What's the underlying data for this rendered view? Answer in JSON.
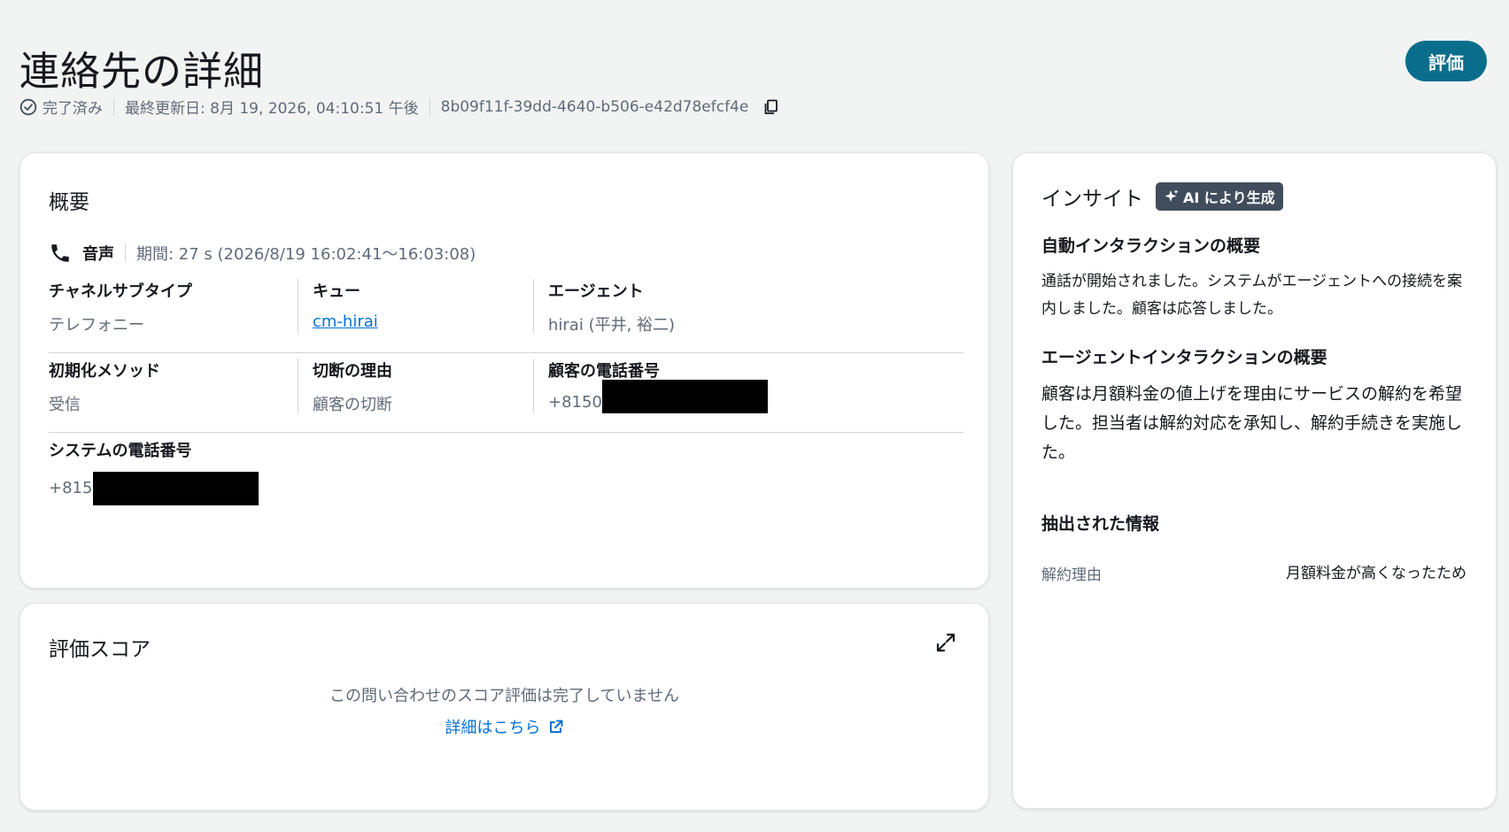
{
  "header": {
    "title": "連絡先の詳細",
    "status": "完了済み",
    "last_updated": "最終更新日: 8月 19, 2026, 04:10:51 午後",
    "contact_id": "8b09f11f-39dd-4640-b506-e42d78efcf4e",
    "evaluate_button": "評価",
    "accent_color": "#0a6d8c"
  },
  "overview": {
    "title": "概要",
    "channel_type": "音声",
    "duration": "期間: 27 s (2026/8/19 16:02:41〜16:03:08)",
    "fields": {
      "channel_subtype_label": "チャネルサブタイプ",
      "channel_subtype_value": "テレフォニー",
      "queue_label": "キュー",
      "queue_value": "cm-hirai",
      "agent_label": "エージェント",
      "agent_value": "hirai (平井, 裕二)",
      "init_method_label": "初期化メソッド",
      "init_method_value": "受信",
      "disconnect_reason_label": "切断の理由",
      "disconnect_reason_value": "顧客の切断",
      "customer_phone_label": "顧客の電話番号",
      "customer_phone_value": "+8150",
      "system_phone_label": "システムの電話番号",
      "system_phone_value": "+815("
    }
  },
  "score": {
    "title": "評価スコア",
    "message": "この問い合わせのスコア評価は完了していません",
    "link": "詳細はこちら"
  },
  "insights": {
    "title": "インサイト",
    "badge": "AI により生成",
    "auto_heading": "自動インタラクションの概要",
    "auto_text": "通話が開始されました。システムがエージェントへの接続を案内しました。顧客は応答しました。",
    "agent_heading": "エージェントインタラクションの概要",
    "agent_text": "顧客は月額料金の値上げを理由にサービスの解約を希望した。担当者は解約対応を承知し、解約手続きを実施した。",
    "extracted_heading": "抽出された情報",
    "extracted_key": "解約理由",
    "extracted_value": "月額料金が高くなったため"
  }
}
